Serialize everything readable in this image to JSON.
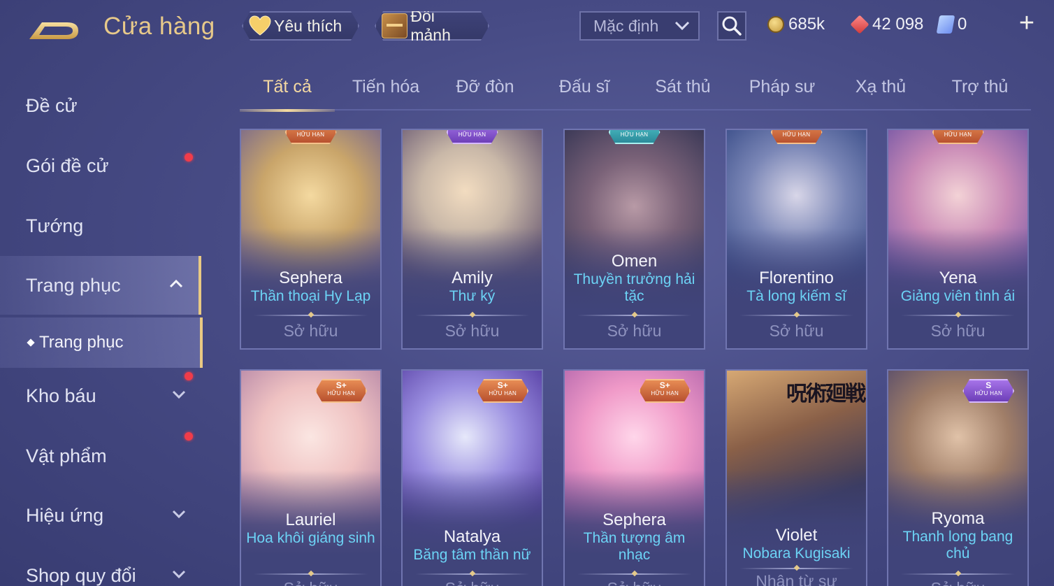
{
  "header": {
    "title": "Cửa hàng",
    "favorites_label": "Yêu thích",
    "exchange_label": "Đổi mảnh",
    "sort_selected": "Mặc định",
    "gold": "685k",
    "vouchers": "42 098",
    "tickets": "0",
    "add_label": "+"
  },
  "sidebar": {
    "items": [
      {
        "label": "Đề cử"
      },
      {
        "label": "Gói đề cử"
      },
      {
        "label": "Tướng"
      },
      {
        "label": "Trang phục"
      },
      {
        "label": "Kho báu"
      },
      {
        "label": "Vật phẩm"
      },
      {
        "label": "Hiệu ứng"
      },
      {
        "label": "Shop quy đổi"
      }
    ],
    "sub_item": "Trang phục"
  },
  "tabs": [
    "Tất cả",
    "Tiến hóa",
    "Đỡ đòn",
    "Đấu sĩ",
    "Sát thủ",
    "Pháp sư",
    "Xạ thủ",
    "Trợ thủ"
  ],
  "cards": [
    {
      "hero": "Sephera",
      "skin": "Thần thoại Hy Lạp",
      "status": "Sở hữu",
      "badge_limited": "HỮU HẠN"
    },
    {
      "hero": "Amily",
      "skin": "Thư ký",
      "status": "Sở hữu",
      "badge_limited": "HỮU HẠN"
    },
    {
      "hero": "Omen",
      "skin": "Thuyền trưởng hải tặc",
      "status": "Sở hữu",
      "badge_limited": "HỮU HẠN"
    },
    {
      "hero": "Florentino",
      "skin": "Tà long kiếm sĩ",
      "status": "Sở hữu",
      "badge_limited": "HỮU HẠN"
    },
    {
      "hero": "Yena",
      "skin": "Giảng viên tình ái",
      "status": "Sở hữu",
      "badge_limited": "HỮU HẠN"
    },
    {
      "hero": "Lauriel",
      "skin": "Hoa khôi giáng sinh",
      "status": "Sở hữu",
      "badge_tier": "S+",
      "badge_limited": "HỮU HẠN"
    },
    {
      "hero": "Natalya",
      "skin": "Băng tâm thần nữ",
      "status": "Sở hữu",
      "badge_tier": "S+",
      "badge_limited": "HỮU HẠN"
    },
    {
      "hero": "Sephera",
      "skin": "Thần tượng âm nhạc",
      "status": "Sở hữu",
      "badge_tier": "S+",
      "badge_limited": "HỮU HẠN"
    },
    {
      "hero": "Violet",
      "skin": "Nobara Kugisaki",
      "status": "Nhận từ sự",
      "art_text": "呪術廻戦"
    },
    {
      "hero": "Ryoma",
      "skin": "Thanh long bang chủ",
      "status": "Sở hữu",
      "badge_tier": "S",
      "badge_limited": "HỮU HẠN"
    }
  ],
  "colors": {
    "accent_gold": "#e7c98a",
    "skin_name_cyan": "#6cd3f5",
    "notification_red": "#f03c4a",
    "badge_orange": "#d46a3c",
    "badge_purple": "#8c58d4"
  }
}
